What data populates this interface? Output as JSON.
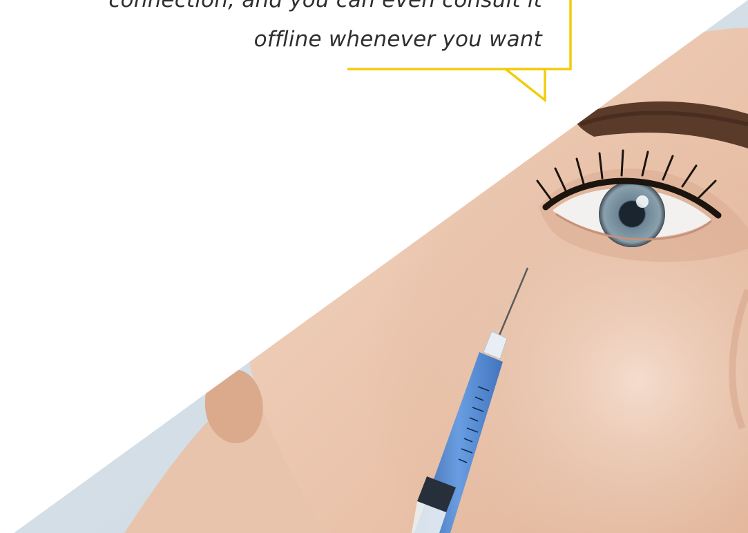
{
  "quote": {
    "line_1": "connection, and you can even consult it",
    "line_2": "offline whenever you want"
  },
  "colors": {
    "bubble_accent": "#F2CC0C",
    "quote_text": "#2F2F2F",
    "background": "#FFFFFF"
  },
  "photo": {
    "subject": "woman-receiving-under-eye-injection",
    "icon": "syringe-icon"
  }
}
